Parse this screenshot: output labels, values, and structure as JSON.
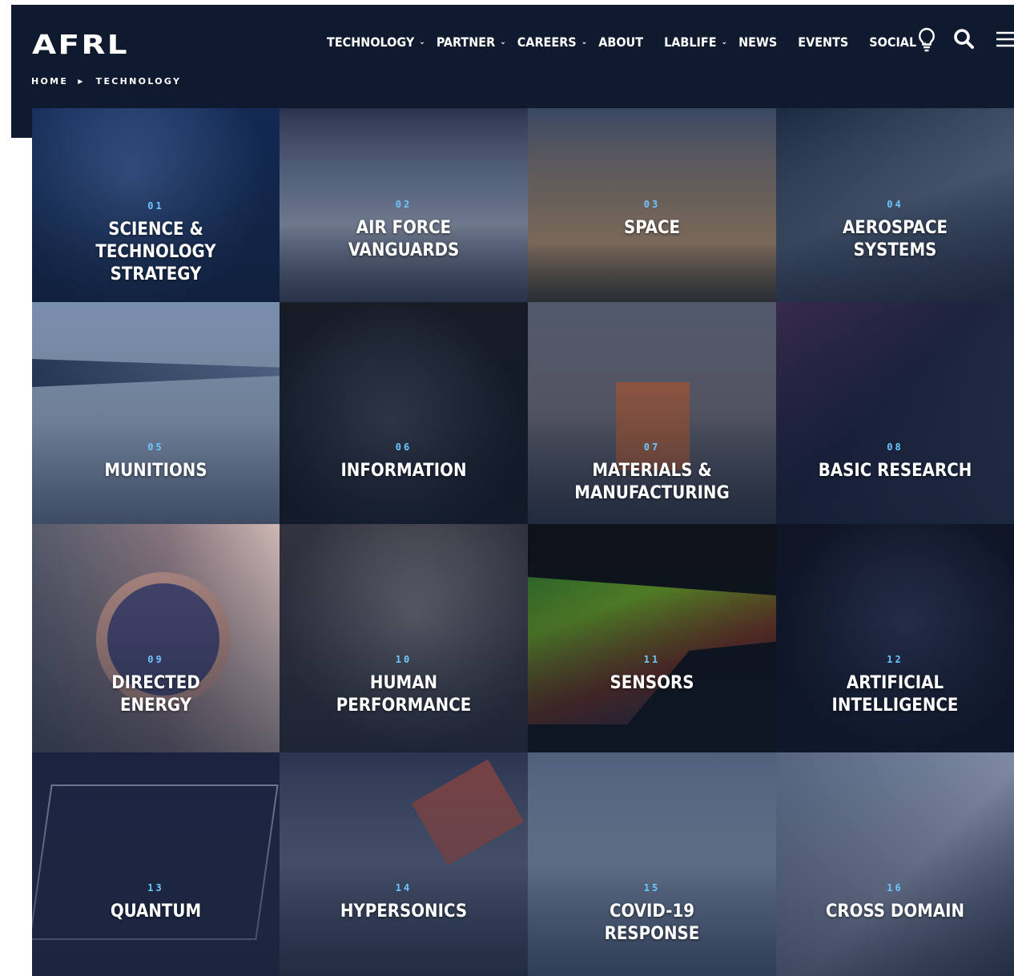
{
  "header": {
    "logo": "AFRL",
    "nav": [
      {
        "label": "TECHNOLOGY",
        "dropdown": true
      },
      {
        "label": "PARTNER",
        "dropdown": true
      },
      {
        "label": "CAREERS",
        "dropdown": true
      },
      {
        "label": "ABOUT",
        "dropdown": false
      },
      {
        "label": "LABLIFE",
        "dropdown": true
      },
      {
        "label": "NEWS",
        "dropdown": false
      },
      {
        "label": "EVENTS",
        "dropdown": false
      },
      {
        "label": "SOCIAL",
        "dropdown": true
      }
    ],
    "icons": [
      "lightbulb-icon",
      "search-icon",
      "menu-icon"
    ]
  },
  "breadcrumb": {
    "home": "HOME",
    "current": "TECHNOLOGY"
  },
  "tiles": [
    {
      "num": "01",
      "title": "SCIENCE &\nTECHNOLOGY\nSTRATEGY",
      "color": "#1f3a6b"
    },
    {
      "num": "02",
      "title": "AIR FORCE\nVANGUARDS",
      "color": "#6a7b98"
    },
    {
      "num": "03",
      "title": "SPACE",
      "color": "#8b6a52"
    },
    {
      "num": "04",
      "title": "AEROSPACE\nSYSTEMS",
      "color": "#3f5068"
    },
    {
      "num": "05",
      "title": "MUNITIONS",
      "color": "#7d93b2"
    },
    {
      "num": "06",
      "title": "INFORMATION",
      "color": "#1c2331"
    },
    {
      "num": "07",
      "title": "MATERIALS &\nMANUFACTURING",
      "color": "#4a5266"
    },
    {
      "num": "08",
      "title": "BASIC RESEARCH",
      "color": "#262c47"
    },
    {
      "num": "09",
      "title": "DIRECTED\nENERGY",
      "color": "#7a6670"
    },
    {
      "num": "10",
      "title": "HUMAN\nPERFORMANCE",
      "color": "#4a4a56"
    },
    {
      "num": "11",
      "title": "SENSORS",
      "color": "#10141a"
    },
    {
      "num": "12",
      "title": "ARTIFICIAL\nINTELLIGENCE",
      "color": "#141a2e"
    },
    {
      "num": "13",
      "title": "QUANTUM",
      "color": "#222b48"
    },
    {
      "num": "14",
      "title": "HYPERSONICS",
      "color": "#3d4a63"
    },
    {
      "num": "15",
      "title": "COVID-19\nRESPONSE",
      "color": "#6f7f99"
    },
    {
      "num": "16",
      "title": "CROSS DOMAIN",
      "color": "#4d5871"
    }
  ]
}
